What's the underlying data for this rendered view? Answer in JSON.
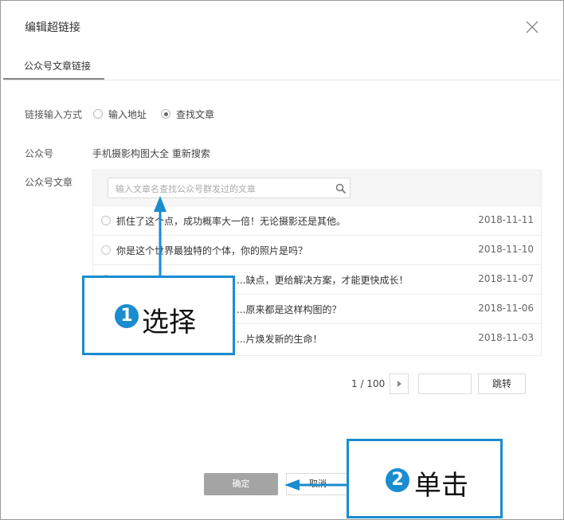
{
  "dialog": {
    "title": "编辑超链接",
    "tab": "公众号文章链接"
  },
  "form": {
    "link_method_label": "链接输入方式",
    "options": [
      "输入地址",
      "查找文章"
    ],
    "selected_option": "查找文章",
    "account_label": "公众号",
    "account_value": "手机摄影构图大全 重新搜索",
    "articles_label": "公众号文章"
  },
  "search": {
    "placeholder": "输入文章名查找公众号群发过的文章",
    "icon": "search-icon"
  },
  "articles": [
    {
      "title": "抓住了这个点，成功概率大一倍！无论摄影还是其他。",
      "date": "2018-11-11"
    },
    {
      "title": "你是这个世界最独特的个体，你的照片是吗？",
      "date": "2018-11-10"
    },
    {
      "title": "...缺点，更给解决方案，才能更快成长！",
      "date": "2018-11-07"
    },
    {
      "title": "...原来都是这样构图的？",
      "date": "2018-11-06"
    },
    {
      "title": "...片焕发新的生命！",
      "date": "2018-11-03"
    }
  ],
  "pagination": {
    "page_text": "1 / 100",
    "jump_label": "跳转"
  },
  "buttons": {
    "ok": "确定",
    "cancel": "取消"
  },
  "callouts": [
    {
      "number": "1",
      "text": "选择"
    },
    {
      "number": "2",
      "text": "单击"
    }
  ],
  "colors": {
    "callout_blue": "#1a8cd0",
    "ok_button": "#a4a4a4"
  }
}
